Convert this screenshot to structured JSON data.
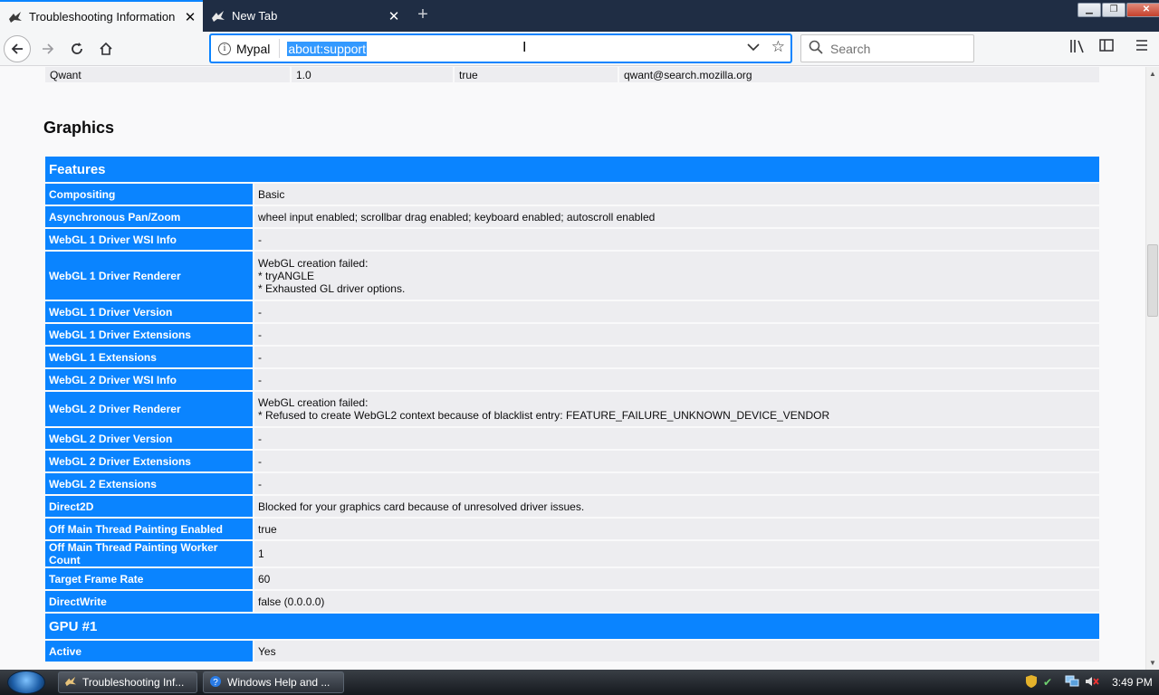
{
  "tabs": [
    {
      "title": "Troubleshooting Information",
      "active": true
    },
    {
      "title": "New Tab",
      "active": false
    }
  ],
  "urlbar": {
    "identity": "Mypal",
    "url": "about:support"
  },
  "search": {
    "placeholder": "Search"
  },
  "prev_table_row": [
    "Qwant",
    "1.0",
    "true",
    "qwant@search.mozilla.org"
  ],
  "graphics": {
    "heading": "Graphics",
    "features_header": "Features",
    "rows": [
      {
        "key": "Compositing",
        "value": [
          "Basic"
        ]
      },
      {
        "key": "Asynchronous Pan/Zoom",
        "value": [
          "wheel input enabled; scrollbar drag enabled; keyboard enabled; autoscroll enabled"
        ]
      },
      {
        "key": "WebGL 1 Driver WSI Info",
        "value": [
          "-"
        ]
      },
      {
        "key": "WebGL 1 Driver Renderer",
        "value": [
          "WebGL creation failed:",
          "* tryANGLE",
          "* Exhausted GL driver options."
        ]
      },
      {
        "key": "WebGL 1 Driver Version",
        "value": [
          "-"
        ]
      },
      {
        "key": "WebGL 1 Driver Extensions",
        "value": [
          "-"
        ]
      },
      {
        "key": "WebGL 1 Extensions",
        "value": [
          "-"
        ]
      },
      {
        "key": "WebGL 2 Driver WSI Info",
        "value": [
          "-"
        ]
      },
      {
        "key": "WebGL 2 Driver Renderer",
        "value": [
          "WebGL creation failed:",
          "* Refused to create WebGL2 context because of blacklist entry: FEATURE_FAILURE_UNKNOWN_DEVICE_VENDOR"
        ]
      },
      {
        "key": "WebGL 2 Driver Version",
        "value": [
          "-"
        ]
      },
      {
        "key": "WebGL 2 Driver Extensions",
        "value": [
          "-"
        ]
      },
      {
        "key": "WebGL 2 Extensions",
        "value": [
          "-"
        ]
      },
      {
        "key": "Direct2D",
        "value": [
          "Blocked for your graphics card because of unresolved driver issues."
        ]
      },
      {
        "key": "Off Main Thread Painting Enabled",
        "value": [
          "true"
        ]
      },
      {
        "key": "Off Main Thread Painting Worker Count",
        "value": [
          "1"
        ]
      },
      {
        "key": "Target Frame Rate",
        "value": [
          "60"
        ]
      },
      {
        "key": "DirectWrite",
        "value": [
          "false (0.0.0.0)"
        ]
      }
    ],
    "gpu_header": "GPU #1",
    "gpu_rows": [
      {
        "key": "Active",
        "value": [
          "Yes"
        ]
      }
    ]
  },
  "taskbar": {
    "tasks": [
      "Troubleshooting Inf...",
      "Windows Help and ..."
    ],
    "clock": "3:49 PM"
  },
  "icons": {
    "back": "back-arrow-icon",
    "forward": "forward-arrow-icon",
    "reload": "reload-icon",
    "home": "home-icon",
    "library": "library-icon",
    "sidebar": "sidebar-icon",
    "menu": "hamburger-menu-icon"
  },
  "colors": {
    "accent": "#0a84ff",
    "tabstrip": "#1f2d44",
    "row_bg": "#ededf0"
  }
}
